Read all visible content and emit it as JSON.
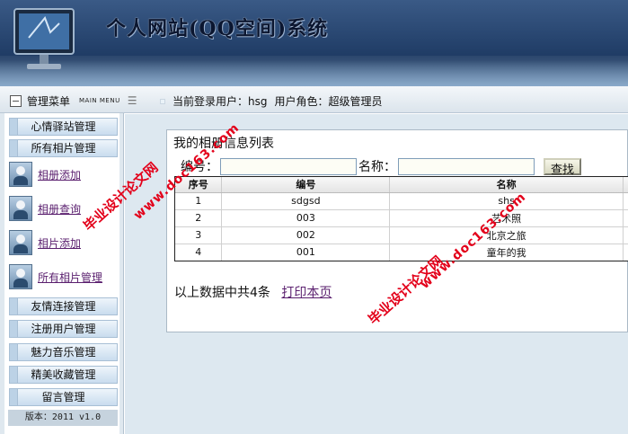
{
  "header": {
    "title": "个人网站(QQ空间)系统"
  },
  "navbar": {
    "menu_title": "管理菜单",
    "menu_subtitle": "MAIN MENU",
    "current_user_label": "当前登录用户：hsg",
    "role_label": "用户角色：超级管理员"
  },
  "sidebar": {
    "items": [
      {
        "type": "button",
        "label": "心情驿站管理"
      },
      {
        "type": "button",
        "label": "所有相片管理"
      },
      {
        "type": "icon-link",
        "label": "相册添加",
        "icon": "user-icon"
      },
      {
        "type": "icon-link",
        "label": "相册查询",
        "icon": "user-icon"
      },
      {
        "type": "icon-link",
        "label": "相片添加",
        "icon": "user-icon"
      },
      {
        "type": "icon-link",
        "label": "所有相片管理",
        "icon": "user-icon"
      },
      {
        "type": "button",
        "label": "友情连接管理"
      },
      {
        "type": "button",
        "label": "注册用户管理"
      },
      {
        "type": "button",
        "label": "魅力音乐管理"
      },
      {
        "type": "button",
        "label": "精美收藏管理"
      },
      {
        "type": "button",
        "label": "留言管理"
      }
    ],
    "version": "版本：2011 v1.0"
  },
  "main": {
    "panel_title": "我的相册信息列表",
    "search": {
      "code_label": "编号：",
      "code_value": "",
      "name_label": "名称：",
      "name_value": "",
      "button_label": "查找"
    },
    "table": {
      "headers": [
        "序号",
        "编号",
        "名称"
      ],
      "rows": [
        [
          "1",
          "sdgsd",
          "shs"
        ],
        [
          "2",
          "003",
          "艺术照"
        ],
        [
          "3",
          "002",
          "北京之旅"
        ],
        [
          "4",
          "001",
          "童年的我"
        ]
      ]
    },
    "summary": "以上数据中共4条",
    "print_link": "打印本页"
  },
  "watermark": {
    "text_cn": "毕业设计论文网",
    "text_url": "www.doc163.com"
  }
}
